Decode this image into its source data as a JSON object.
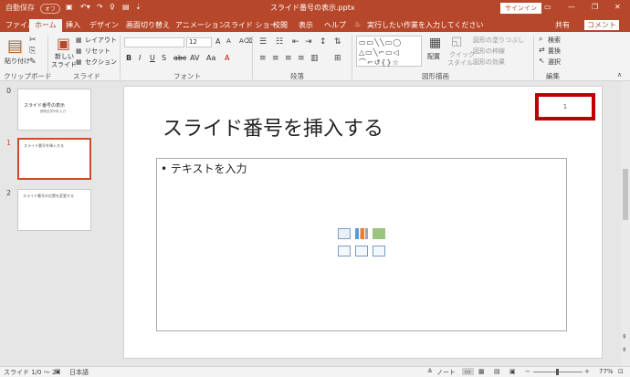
{
  "titlebar": {
    "autosave_label": "自動保存",
    "autosave_state": "オフ",
    "doc_title": "スライド番号の表示.pptx",
    "signin_label": "サインイン",
    "accent": "#b7472a"
  },
  "tabs": {
    "items": [
      "ファイル",
      "ホーム",
      "挿入",
      "デザイン",
      "画面切り替え",
      "アニメーション",
      "スライド ショー",
      "校閲",
      "表示",
      "ヘルプ"
    ],
    "search_placeholder": "実行したい作業を入力してください",
    "share_label": "共有",
    "comment_label": "コメント"
  },
  "ribbon": {
    "clipboard": {
      "paste": "貼り付け",
      "group": "クリップボード"
    },
    "slides": {
      "new_slide_1": "新しい",
      "new_slide_2": "スライド",
      "layout": "レイアウト",
      "reset": "リセット",
      "section": "セクション",
      "group": "スライド"
    },
    "font": {
      "size": "12",
      "group": "フォント"
    },
    "paragraph": {
      "group": "段落"
    },
    "drawing": {
      "arrange": "配置",
      "quick_style_1": "クイック",
      "quick_style_2": "スタイル",
      "fill": "図形の塗りつぶし",
      "outline": "図形の枠線",
      "effects": "図形の効果",
      "group": "図形描画"
    },
    "editing": {
      "find": "検索",
      "replace": "置換",
      "select": "選択",
      "group": "編集"
    }
  },
  "thumbnails": [
    {
      "number": "0",
      "text": "スライド番号の表示",
      "subtitle": "説明文字列を入力"
    },
    {
      "number": "1",
      "text": "スライド番号を挿入する",
      "selected": true
    },
    {
      "number": "2",
      "text": "スライド番号の位置を変更する"
    }
  ],
  "slide": {
    "title": "スライド番号を挿入する",
    "bullet": "• テキストを入力",
    "slide_number": "1",
    "highlight_color": "#c00000"
  },
  "statusbar": {
    "slide_info": "スライド 1/0 ～ 2",
    "language": "日本語",
    "notes": "ノート",
    "zoom": "77%"
  }
}
